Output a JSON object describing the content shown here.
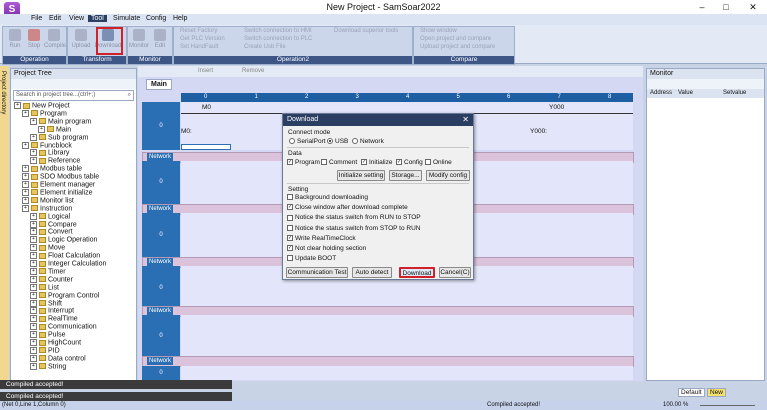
{
  "window": {
    "title": "New Project - SamSoar2022"
  },
  "menu": [
    "File",
    "Edit",
    "View",
    "Tool",
    "Simulate",
    "Config",
    "Help"
  ],
  "ribbon": {
    "groups": {
      "operation": "Operation",
      "transform": "Transform",
      "monitor": "Monitor",
      "operation2": "Operation2",
      "compare": "Compare"
    },
    "buttons": {
      "run": "Run",
      "stop": "Stop",
      "compile": "Compile",
      "upload": "Upload",
      "download": "Download",
      "monitor": "Monitor",
      "edit": "Edit"
    },
    "lines": {
      "reset_factory": "Reset Factory",
      "get_plc_version": "Get PLC Version",
      "set_handfault": "Set HandFault",
      "switch_hmi": "Switch connection to HMI",
      "switch_plc": "Switch connection to PLC",
      "create_usb_file": "Create Usb File",
      "download_superior_tools": "Download superior tools",
      "show_window": "Show window",
      "open_compare": "Open project and compare",
      "upload_compare": "Upload project and compare"
    }
  },
  "project_tree": {
    "title": "Project Tree",
    "search_placeholder": "Search in project tree...(ctrl+;)",
    "items": [
      "New Project",
      "Program",
      "Main program",
      "Main",
      "Sub program",
      "Funcblock",
      "Library",
      "Reference",
      "Modbus table",
      "SDO Modbus table",
      "Element manager",
      "Element initialize",
      "Monitor list",
      "Instruction",
      "Logical",
      "Compare",
      "Convert",
      "Logic Operation",
      "Move",
      "Float Calculation",
      "Integer Calculation",
      "Timer",
      "Counter",
      "List",
      "Program Control",
      "Shift",
      "Interrupt",
      "RealTime",
      "Communication",
      "Pulse",
      "HighCount",
      "PID",
      "Data control",
      "String"
    ]
  },
  "side_strip_label": "Project directory",
  "editor": {
    "toolbar": {
      "insert": "Insert",
      "remove": "Remove"
    },
    "tab": "Main",
    "columns": [
      "0",
      "1",
      "2",
      "3",
      "4",
      "5",
      "6",
      "7",
      "8"
    ],
    "network_label": "Network",
    "rung": {
      "contact": "M0",
      "contact_addr": "M0:",
      "coil": "Y000",
      "coil_addr": "Y000:"
    },
    "row_numbers": [
      "0",
      "1",
      "0",
      "1",
      "0",
      "1",
      "0",
      "1",
      "0",
      "1",
      "0"
    ]
  },
  "monitor": {
    "title": "Monitor",
    "columns": [
      "Address",
      "Value",
      "Setvalue"
    ],
    "tabs": [
      "Default",
      "New"
    ]
  },
  "dialog": {
    "title": "Download",
    "connect_mode_label": "Connect mode",
    "connect_options": [
      "SerialPort",
      "USB",
      "Network"
    ],
    "data_label": "Data",
    "data_options": [
      "Program",
      "Comment",
      "Initialize",
      "Config",
      "Online"
    ],
    "buttons_row1": [
      "Initialize setting",
      "Storage...",
      "Modify config"
    ],
    "setting_label": "Setting",
    "settings": [
      "Background downloading",
      "Close window after download complete",
      "Notice the status switch from RUN to STOP",
      "Notice the status switch from STOP to RUN",
      "Write RealTimeClock",
      "Not clear holding section",
      "Update BOOT"
    ],
    "settings_checked": [
      false,
      true,
      false,
      false,
      true,
      true,
      false
    ],
    "footer_buttons": [
      "Communication Test",
      "Auto detect",
      "Download",
      "Cancel(C)"
    ]
  },
  "messages": [
    "Compiled accepted!",
    "Compiled accepted!"
  ],
  "status": {
    "position": "(Net 0,Line 1,Column 0)",
    "center": "Compiled accepted!",
    "zoom": "100.00 %"
  },
  "colors": {
    "highlight": "#d0202a",
    "accent": "#1e5fa3"
  }
}
